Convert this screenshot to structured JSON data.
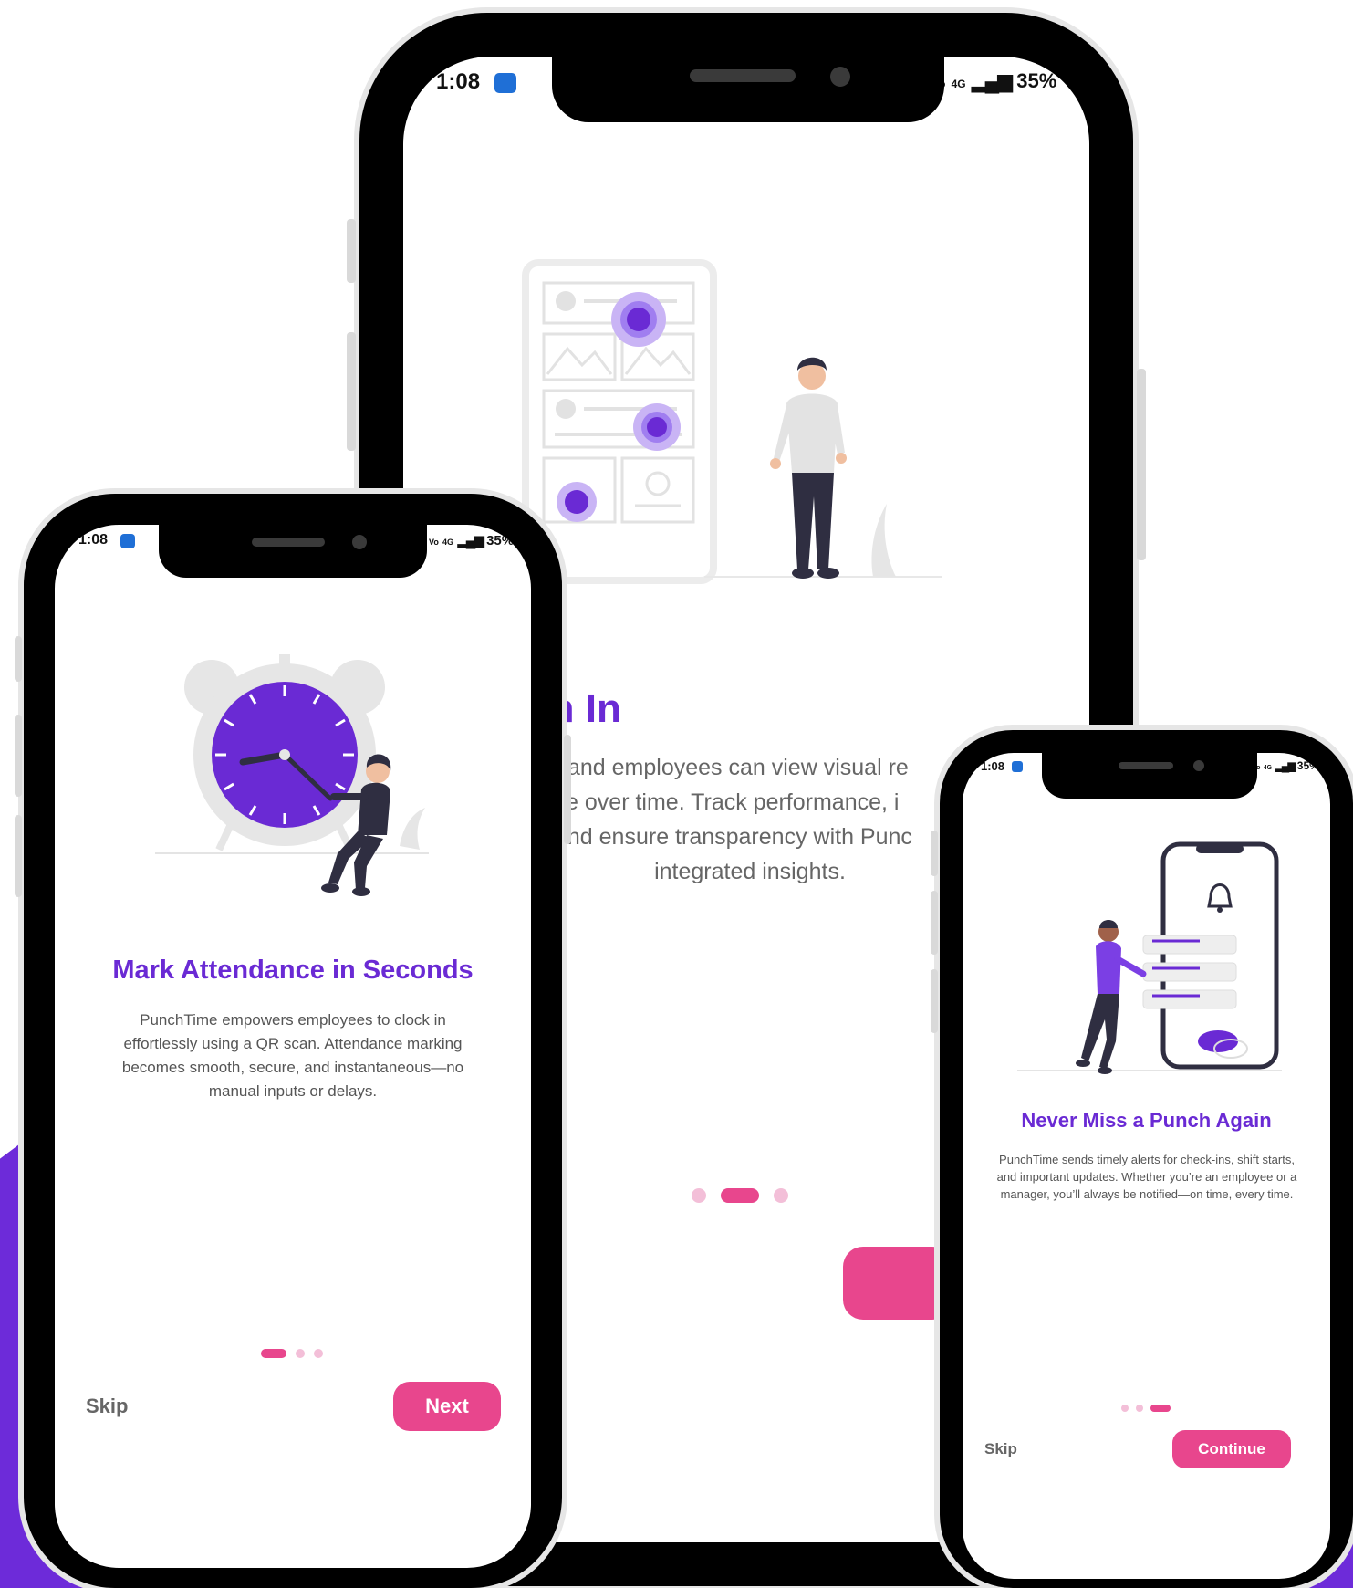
{
  "colors": {
    "brand_purple": "#6d2bd9",
    "title_purple": "#6a2ad4",
    "accent_pink": "#e8468d",
    "dot_inactive": "#f3bfd8"
  },
  "status_bar": {
    "time": "1:08",
    "signal": "4G",
    "battery": "35%",
    "icons": [
      "app-notification-icon",
      "volte-icon",
      "signal-icon",
      "battery-text"
    ]
  },
  "screens": [
    {
      "id": "mark-attendance",
      "title": "Mark Attendance in Seconds",
      "description": "PunchTime empowers employees to clock in effortlessly using a QR scan. Attendance marking becomes smooth, secure, and instantaneous—no manual inputs or delays.",
      "page_indicator": {
        "count": 3,
        "active": 1
      },
      "skip_label": "Skip",
      "primary_label": "Next",
      "illustration": "alarm-clock-woman-illustration"
    },
    {
      "id": "attendance-insights",
      "title": "r Attendance with In",
      "description_lines": [
        "and employees can view visual re",
        "ice over time. Track performance, i",
        "and ensure transparency with Punc",
        "integrated insights."
      ],
      "page_indicator": {
        "count": 3,
        "active": 2
      },
      "illustration": "analytics-man-illustration"
    },
    {
      "id": "never-miss-punch",
      "title": "Never Miss a Punch Again",
      "description": "PunchTime sends timely alerts for check-ins, shift starts, and important updates. Whether you’re an employee or a manager, you’ll always be notified—on time, every time.",
      "page_indicator": {
        "count": 3,
        "active": 3
      },
      "skip_label": "Skip",
      "primary_label": "Continue",
      "illustration": "notification-phone-illustration"
    }
  ]
}
